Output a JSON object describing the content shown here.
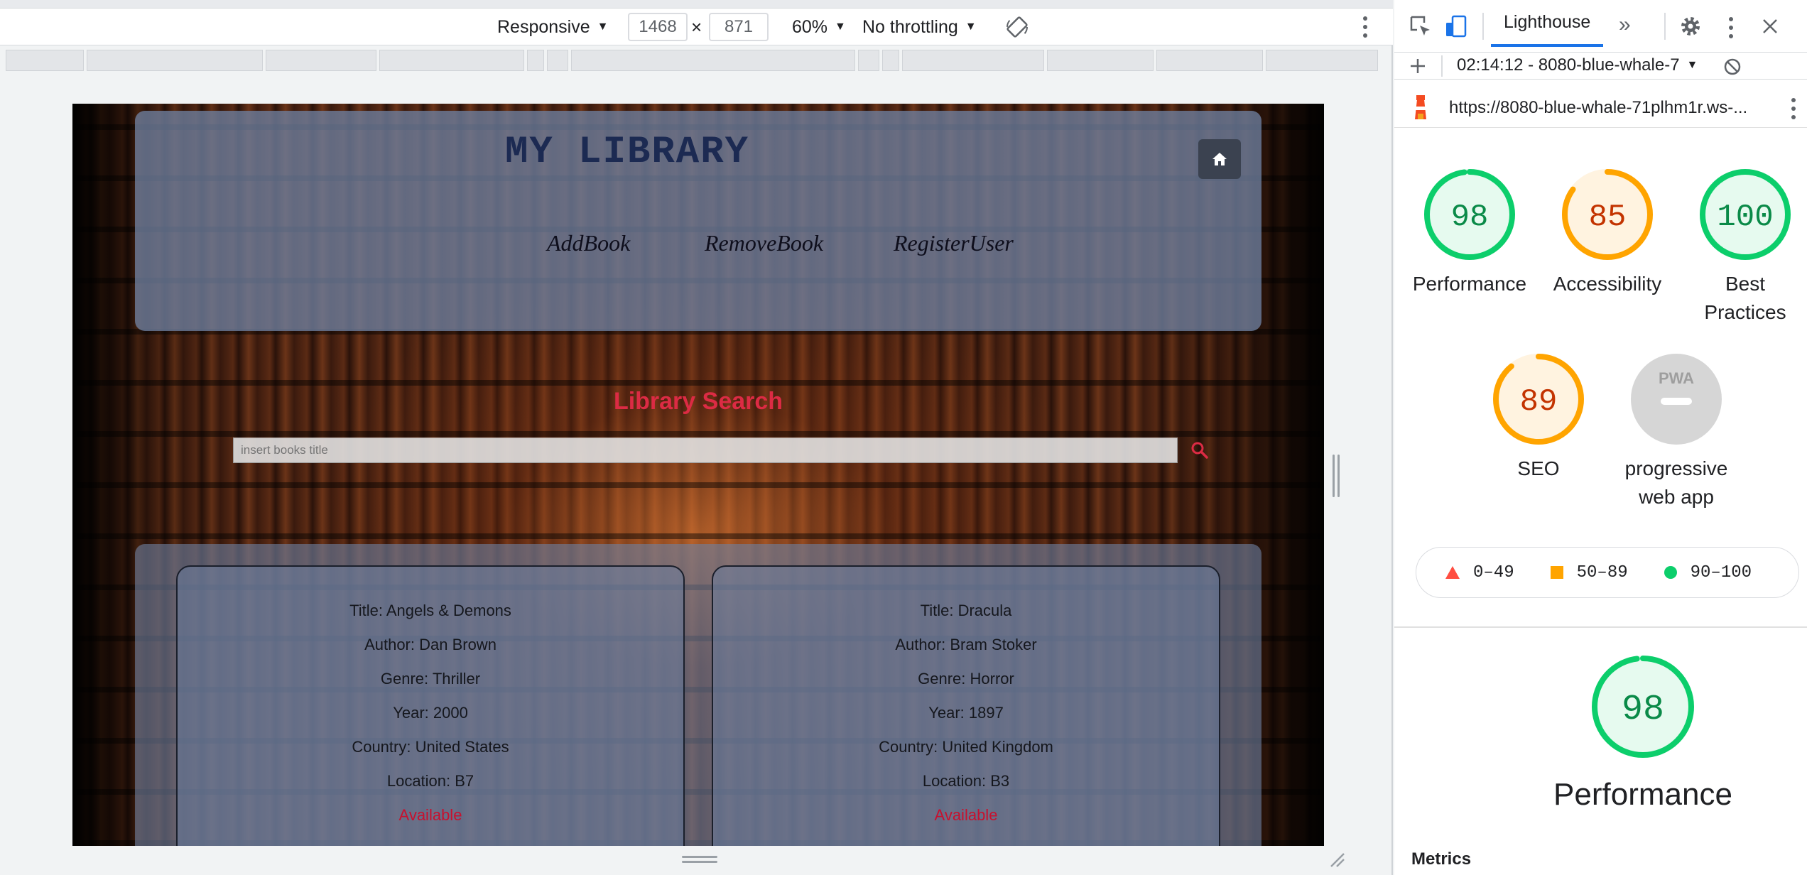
{
  "device_toolbar": {
    "device_mode": "Responsive",
    "width": "1468",
    "times": "×",
    "height": "871",
    "zoom": "60%",
    "throttling": "No throttling"
  },
  "site": {
    "title": "MY LIBRARY",
    "nav": [
      "AddBook",
      "RemoveBook",
      "RegisterUser"
    ],
    "search_heading": "Library Search",
    "search_placeholder": "insert books title",
    "books": [
      {
        "title": "Title: Angels & Demons",
        "author": "Author: Dan Brown",
        "genre": "Genre: Thriller",
        "year": "Year: 2000",
        "country": "Country: United States",
        "location": "Location: B7",
        "status": "Available"
      },
      {
        "title": "Title: Dracula",
        "author": "Author: Bram Stoker",
        "genre": "Genre: Horror",
        "year": "Year: 1897",
        "country": "Country: United Kingdom",
        "location": "Location: B3",
        "status": "Available"
      }
    ]
  },
  "lighthouse": {
    "tab_label": "Lighthouse",
    "more_tabs": "»",
    "report_name": "02:14:12 - 8080-blue-whale-7",
    "url": "https://8080-blue-whale-71plhm1r.ws-...",
    "scores": [
      {
        "label": "Performance",
        "value": "98",
        "fraction": 0.98,
        "color": "#0cce6b"
      },
      {
        "label": "Accessibility",
        "value": "85",
        "fraction": 0.85,
        "color": "#ffa400"
      },
      {
        "label": "Best Practices",
        "value": "100",
        "fraction": 1.0,
        "color": "#0cce6b"
      },
      {
        "label": "SEO",
        "value": "89",
        "fraction": 0.89,
        "color": "#ffa400"
      },
      {
        "label": "progressive web app",
        "value": "PWA",
        "fraction": 0,
        "color": "#cccccc"
      }
    ],
    "legend": [
      "0–49",
      "50–89",
      "90–100"
    ],
    "legend_colors": {
      "fail": "#ff4e42",
      "average": "#ffa400",
      "pass": "#0cce6b"
    },
    "performance_big": {
      "value": "98",
      "label": "Performance",
      "fraction": 0.98
    },
    "metrics_heading": "Metrics"
  }
}
